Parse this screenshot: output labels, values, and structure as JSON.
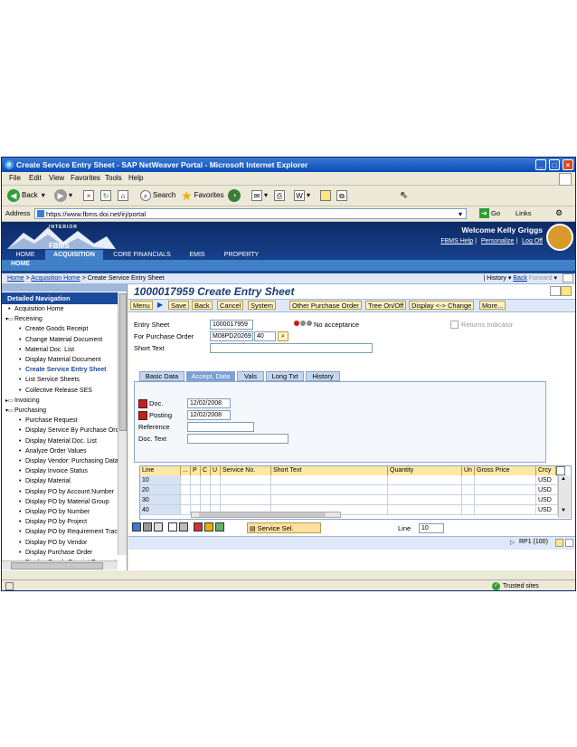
{
  "window": {
    "title": "Create Service Entry Sheet - SAP NetWeaver Portal - Microsoft Internet Explorer",
    "controls": {
      "minimize": "_",
      "maximize": "□",
      "close": "×"
    }
  },
  "menubar": [
    "File",
    "Edit",
    "View",
    "Favorites",
    "Tools",
    "Help"
  ],
  "toolbar": {
    "back": "Back",
    "search": "Search",
    "favorites": "Favorites"
  },
  "addressbar": {
    "label": "Address",
    "url": "https://www.fbms.doi.net/irj/portal",
    "go": "Go",
    "links": "Links"
  },
  "portal": {
    "brand_top": "INTERIOR",
    "brand": "FBMS",
    "tabs": [
      "HOME",
      "ACQUISITION",
      "CORE FINANCIALS",
      "EMIS",
      "PROPERTY"
    ],
    "active_tab": "ACQUISITION",
    "subnav": "HOME",
    "welcome": "Welcome Kelly Griggs",
    "links": [
      "FBMS Help",
      "Personalize",
      "Log Off"
    ]
  },
  "breadcrumb": {
    "home": "Home",
    "sep1": " > ",
    "acq": "Acquisition Home",
    "sep2": " > ",
    "current": "Create Service Entry Sheet",
    "history": "History",
    "back": "Back",
    "forward": "Forward"
  },
  "nav": {
    "title": "Detailed Navigation",
    "items": [
      {
        "label": "Acquisition Home",
        "level": 0,
        "type": "bullet"
      },
      {
        "label": "Receiving",
        "level": 0,
        "type": "folder-open"
      },
      {
        "label": "Create Goods Receipt",
        "level": 1,
        "type": "bullet"
      },
      {
        "label": "Change Material Document",
        "level": 1,
        "type": "bullet"
      },
      {
        "label": "Material Doc. List",
        "level": 1,
        "type": "bullet"
      },
      {
        "label": "Display Material Document",
        "level": 1,
        "type": "bullet"
      },
      {
        "label": "Create Service Entry Sheet",
        "level": 1,
        "type": "bullet",
        "active": true
      },
      {
        "label": "List Service Sheets",
        "level": 1,
        "type": "bullet"
      },
      {
        "label": "Collective Release SES",
        "level": 1,
        "type": "bullet"
      },
      {
        "label": "Invoicing",
        "level": 0,
        "type": "folder-closed"
      },
      {
        "label": "Purchasing",
        "level": 0,
        "type": "folder-open"
      },
      {
        "label": "Purchase Request",
        "level": 1,
        "type": "bullet"
      },
      {
        "label": "Display Service By Purchase Ord",
        "level": 1,
        "type": "bullet"
      },
      {
        "label": "Display Material Doc. List",
        "level": 1,
        "type": "bullet"
      },
      {
        "label": "Analyze Order Values",
        "level": 1,
        "type": "bullet"
      },
      {
        "label": "Display Vendor: Purchasing Data",
        "level": 1,
        "type": "bullet"
      },
      {
        "label": "Display Invoice Status",
        "level": 1,
        "type": "bullet"
      },
      {
        "label": "Display Material",
        "level": 1,
        "type": "bullet"
      },
      {
        "label": "Display PO by Account Number",
        "level": 1,
        "type": "bullet"
      },
      {
        "label": "Display PO by Material Group",
        "level": 1,
        "type": "bullet"
      },
      {
        "label": "Display PO by Number",
        "level": 1,
        "type": "bullet"
      },
      {
        "label": "Display PO by Project",
        "level": 1,
        "type": "bullet"
      },
      {
        "label": "Display PO by Requirement Tracki",
        "level": 1,
        "type": "bullet"
      },
      {
        "label": "Display PO by Vendor",
        "level": 1,
        "type": "bullet"
      },
      {
        "label": "Display Purchase Order",
        "level": 1,
        "type": "bullet"
      },
      {
        "label": "Display Goods Receipt Forecast",
        "level": 1,
        "type": "bullet"
      }
    ]
  },
  "page": {
    "title": "1000017959 Create Entry Sheet",
    "buttons": [
      "Menu",
      "Save",
      "Back",
      "Cancel",
      "System",
      "Other Purchase Order",
      "Tree On/Off",
      "Display <-> Change",
      "More..."
    ],
    "fields": {
      "entry_sheet_label": "Entry Sheet",
      "entry_sheet_value": "1000017959",
      "po_label": "For Purchase Order",
      "po_value": "M08PD20269",
      "po_item": "40",
      "short_text_label": "Short Text",
      "short_text_value": "",
      "status_text": "No acceptance",
      "returns_label": "Returns Indicator"
    },
    "tabs": [
      "Basic Data",
      "Accept. Data",
      "Vals",
      "Long Txt",
      "History"
    ],
    "active_tab": "Accept. Data",
    "accept": {
      "doc_label": "Doc.",
      "doc_value": "12/02/2008",
      "posting_label": "Posting",
      "posting_value": "12/02/2008",
      "reference_label": "Reference",
      "reference_value": "",
      "doctext_label": "Doc. Text",
      "doctext_value": ""
    },
    "grid": {
      "headers": [
        "Line",
        "...",
        "P",
        "C",
        "U",
        "Service No.",
        "Short Text",
        "Quantity",
        "Un",
        "Gross Price",
        "Crcy"
      ],
      "rows": [
        {
          "line": "10",
          "crcy": "USD"
        },
        {
          "line": "20",
          "crcy": "USD"
        },
        {
          "line": "30",
          "crcy": "USD"
        },
        {
          "line": "40",
          "crcy": "USD"
        }
      ]
    },
    "service_sel": "Service Sel.",
    "line_label": "Line",
    "line_value": "10",
    "system_status": "RP1 (100)"
  },
  "iestatus": {
    "zone": "Trusted sites"
  }
}
